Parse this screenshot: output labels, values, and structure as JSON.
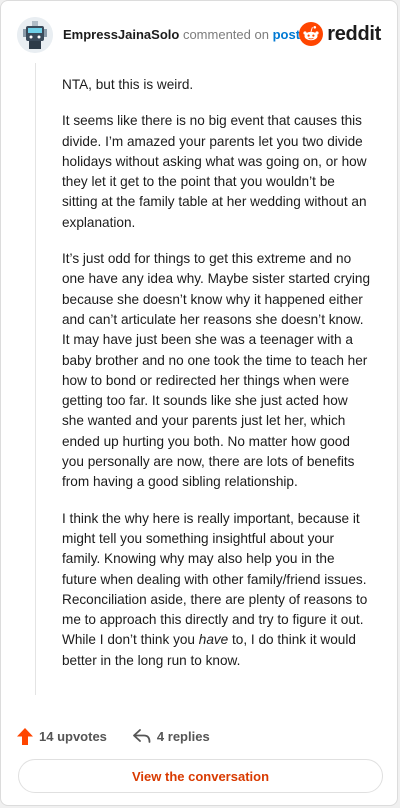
{
  "header": {
    "username": "EmpressJainaSolo",
    "verb": "commented on",
    "post_link": "post",
    "brand": "reddit"
  },
  "comment": {
    "paragraphs": [
      "NTA, but this is weird.",
      "It seems like there is no big event that causes this divide. I’m amazed your parents let you two divide holidays without asking what was going on, or how they let it get to the point that you wouldn’t be sitting at the family table at her wedding without an explanation.",
      "It’s just odd for things to get this extreme and no one have any idea why. Maybe sister started crying because she doesn’t know why it happened either and can’t articulate her reasons she doesn’t know. It may have just been she was a teenager with a baby brother and no one took the time to teach her how to bond or redirected her things when were getting too far. It sounds like she just acted how she wanted and your parents just let her, which ended up hurting you both. No matter how good you personally are now, there are lots of benefits from having a good sibling relationship."
    ],
    "last_paragraph_before": "I think the why here is really important, because it might tell you something insightful about your family. Knowing why may also help you in the future when dealing with other family/friend issues. Reconciliation aside, there are plenty of reasons to me to approach this directly and try to figure it out. While I don’t think you ",
    "last_paragraph_em": "have",
    "last_paragraph_after": " to, I do think it would better in the long run to know."
  },
  "footer": {
    "upvotes": "14 upvotes",
    "replies": "4 replies",
    "view_button": "View the conversation"
  },
  "colors": {
    "brand": "#ff4500",
    "link": "#0079d3",
    "button_text": "#d93a00"
  },
  "icons": [
    "avatar",
    "reddit-logo-icon",
    "upvote-arrow-icon",
    "reply-icon"
  ]
}
